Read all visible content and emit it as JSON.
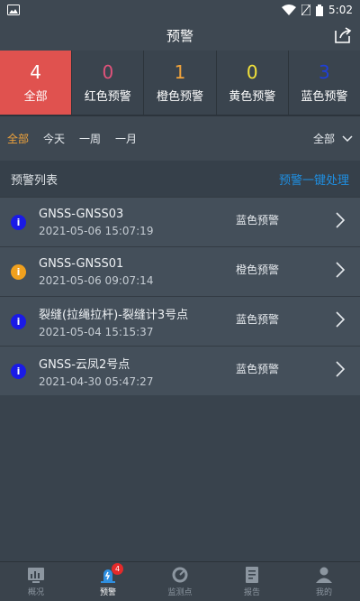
{
  "status_bar": {
    "time": "5:02"
  },
  "header": {
    "title": "预警"
  },
  "counters": [
    {
      "count": "4",
      "label": "全部",
      "color": "#ffffff"
    },
    {
      "count": "0",
      "label": "红色预警",
      "color": "#e0527a"
    },
    {
      "count": "1",
      "label": "橙色预警",
      "color": "#f0a33b"
    },
    {
      "count": "0",
      "label": "黄色预警",
      "color": "#f2e23a"
    },
    {
      "count": "3",
      "label": "蓝色预警",
      "color": "#1f3fd8"
    }
  ],
  "filters": {
    "tabs": [
      "全部",
      "今天",
      "一周",
      "一月"
    ],
    "active_tab": "全部",
    "dropdown_value": "全部"
  },
  "list_header": {
    "title": "预警列表",
    "action": "预警一键处理"
  },
  "alerts": [
    {
      "name": "GNSS-GNSS03",
      "time": "2021-05-06 15:07:19",
      "level": "蓝色预警",
      "icon_color": "#1a1ae6"
    },
    {
      "name": "GNSS-GNSS01",
      "time": "2021-05-06 09:07:14",
      "level": "橙色预警",
      "icon_color": "#f0a01e"
    },
    {
      "name": "裂缝(拉绳拉杆)-裂缝计3号点",
      "time": "2021-05-04 15:15:37",
      "level": "蓝色预警",
      "icon_color": "#1a1ae6"
    },
    {
      "name": "GNSS-云凤2号点",
      "time": "2021-04-30 05:47:27",
      "level": "蓝色预警",
      "icon_color": "#1a1ae6"
    }
  ],
  "bottom_nav": [
    {
      "label": "概况",
      "icon": "chart-icon"
    },
    {
      "label": "预警",
      "icon": "alert-icon",
      "badge": "4",
      "active": true
    },
    {
      "label": "监测点",
      "icon": "gauge-icon"
    },
    {
      "label": "报告",
      "icon": "report-icon"
    },
    {
      "label": "我的",
      "icon": "user-icon"
    }
  ]
}
